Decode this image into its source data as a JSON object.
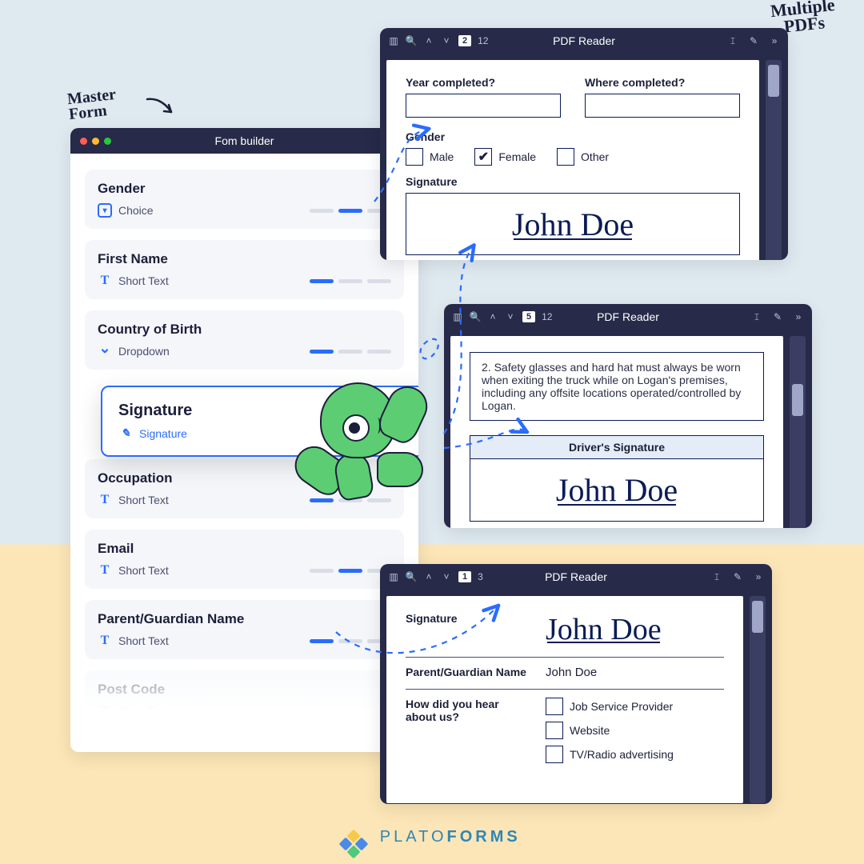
{
  "annotations": {
    "master_form": "Master\nForm",
    "multiple_pdfs": "Multiple\nPDFs"
  },
  "builder": {
    "title": "Fom builder",
    "fields": [
      {
        "title": "Gender",
        "type_label": "Choice",
        "type_icon": "choice",
        "bars": [
          0,
          1,
          0
        ]
      },
      {
        "title": "First Name",
        "type_label": "Short Text",
        "type_icon": "text",
        "bars": [
          1,
          0,
          0
        ]
      },
      {
        "title": "Country of Birth",
        "type_label": "Dropdown",
        "type_icon": "dropdown",
        "bars": [
          1,
          0,
          0
        ]
      },
      {
        "title": "Signature",
        "type_label": "Signature",
        "type_icon": "sig",
        "bars": [],
        "selected": true
      },
      {
        "title": "Occupation",
        "type_label": "Short Text",
        "type_icon": "text",
        "bars": [
          1,
          0,
          0
        ]
      },
      {
        "title": "Email",
        "type_label": "Short Text",
        "type_icon": "text",
        "bars": [
          0,
          1,
          0
        ]
      },
      {
        "title": "Parent/Guardian Name",
        "type_label": "Short Text",
        "type_icon": "text",
        "bars": [
          1,
          0,
          0
        ]
      },
      {
        "title": "Post Code",
        "type_label": "Short Text",
        "type_icon": "text",
        "bars": [
          0,
          0,
          0
        ]
      }
    ]
  },
  "reader_title": "PDF Reader",
  "reader1": {
    "page_current": "2",
    "page_total": "12",
    "q_year": "Year completed?",
    "q_where": "Where completed?",
    "gender_label": "Gender",
    "g_male": "Male",
    "g_female": "Female",
    "g_other": "Other",
    "signature_label": "Signature",
    "sig_text": "John Doe"
  },
  "reader2": {
    "page_current": "5",
    "page_total": "12",
    "paragraph": "2. Safety glasses and hard hat must always be worn when exiting the truck while on Logan's premises, including any offsite locations operated/controlled by Logan.",
    "driver_sig_label": "Driver's Signature",
    "sig_text": "John Doe"
  },
  "reader3": {
    "page_current": "1",
    "page_total": "3",
    "row_sig_label": "Signature",
    "sig_text": "John Doe",
    "row_pg_label": "Parent/Guardian Name",
    "row_pg_value": "John Doe",
    "row_hear_label": "How did you hear about us?",
    "opts": [
      "Job Service Provider",
      "Website",
      "TV/Radio advertising"
    ]
  },
  "brand": {
    "name1": "PLATO",
    "name2": "FORMS"
  }
}
